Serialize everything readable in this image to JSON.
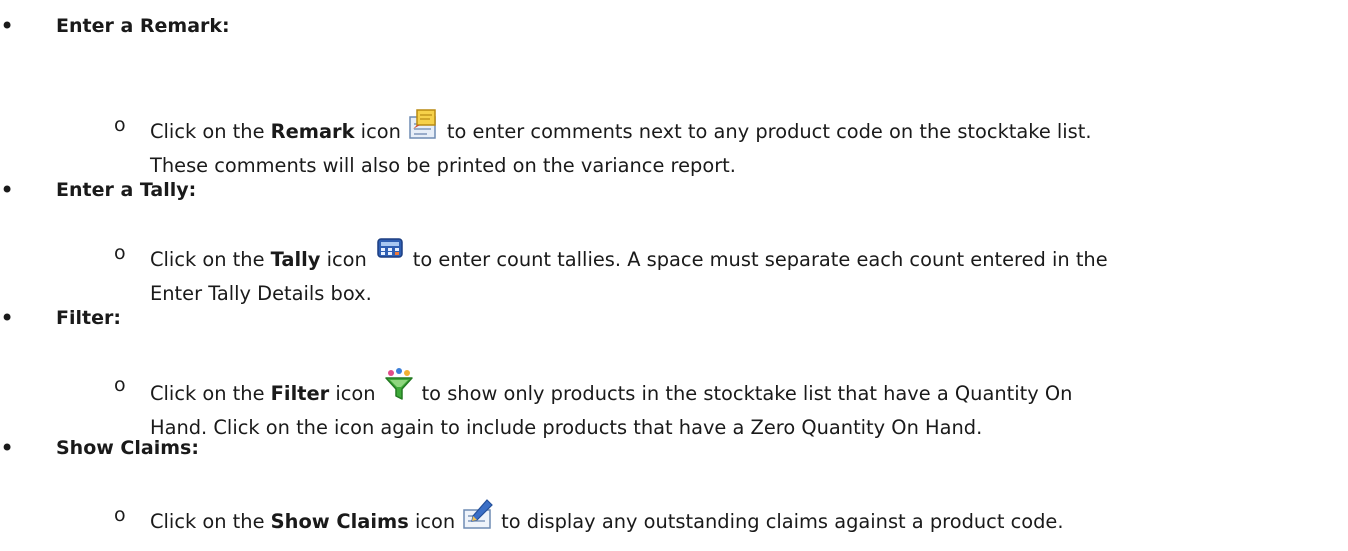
{
  "items": [
    {
      "heading": "Enter a Remark:",
      "marker": "o",
      "pre": "Click on the ",
      "bold": "Remark",
      "mid": " icon",
      "icon": "remark-icon",
      "post": "to enter comments next to any product code on the stocktake list.",
      "cont": "These comments will also be printed on the variance report."
    },
    {
      "heading": "Enter a Tally:",
      "marker": "o",
      "pre": "Click on the ",
      "bold": "Tally",
      "mid": " icon",
      "icon": "tally-icon",
      "post": "to enter count tallies. A space must separate each count entered in the",
      "cont": "Enter Tally Details box."
    },
    {
      "heading": "Filter:",
      "marker": "o",
      "pre": "Click on the ",
      "bold": "Filter",
      "mid": " icon",
      "icon": "filter-icon",
      "post": "to show only products in the stocktake list that have a Quantity On",
      "cont": "Hand. Click on the icon again to include products that have a Zero Quantity On Hand."
    },
    {
      "heading": "Show Claims:",
      "marker": "o",
      "pre": "Click on the ",
      "bold": "Show Claims",
      "mid": " icon",
      "icon": "show-claims-icon",
      "post": "to display any outstanding claims against a product code.",
      "cont": ""
    }
  ]
}
